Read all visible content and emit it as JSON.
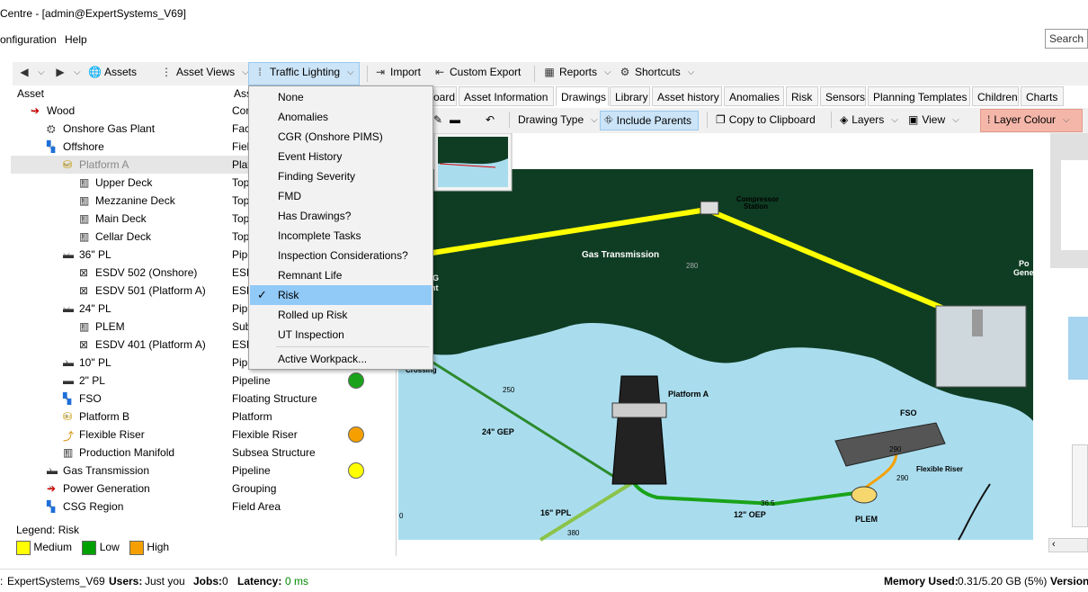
{
  "window": {
    "title": "Centre - [admin@ExpertSystems_V69]"
  },
  "menu": {
    "items": [
      "onfiguration",
      "Help"
    ],
    "search_placeholder": "Search N"
  },
  "toolbar": {
    "assets": "Assets",
    "asset_views": "Asset Views",
    "traffic_lighting": "Traffic Lighting",
    "import": "Import",
    "custom_export": "Custom Export",
    "reports": "Reports",
    "shortcuts": "Shortcuts"
  },
  "tree": {
    "col_asset": "Asset",
    "col_type": "Ass",
    "rows": [
      {
        "name": "Wood",
        "type": "Cor"
      },
      {
        "name": "Onshore Gas Plant",
        "type": "Fac"
      },
      {
        "name": "Offshore",
        "type": "Fiel"
      },
      {
        "name": "Platform A",
        "type": "Plat"
      },
      {
        "name": "Upper Deck",
        "type": "Top"
      },
      {
        "name": "Mezzanine Deck",
        "type": "Top"
      },
      {
        "name": "Main Deck",
        "type": "Top"
      },
      {
        "name": "Cellar Deck",
        "type": "Top"
      },
      {
        "name": "36\" PL",
        "type": "Pipe"
      },
      {
        "name": "ESDV 502 (Onshore)",
        "type": "ESD"
      },
      {
        "name": "ESDV 501 (Platform A)",
        "type": "ESD"
      },
      {
        "name": "24\" PL",
        "type": "Pip"
      },
      {
        "name": "PLEM",
        "type": "Sub"
      },
      {
        "name": "ESDV 401 (Platform A)",
        "type": "ESD"
      },
      {
        "name": "10\" PL",
        "type": "Pip"
      },
      {
        "name": "2\" PL",
        "type": "Pipeline",
        "risk": "Low"
      },
      {
        "name": "FSO",
        "type": "Floating Structure"
      },
      {
        "name": "Platform B",
        "type": "Platform"
      },
      {
        "name": "Flexible Riser",
        "type": "Flexible Riser",
        "risk": "High"
      },
      {
        "name": "Production Manifold",
        "type": "Subsea Structure"
      },
      {
        "name": "Gas Transmission",
        "type": "Pipeline",
        "risk": "Medium"
      },
      {
        "name": "Power Generation",
        "type": "Grouping"
      },
      {
        "name": "CSG Region",
        "type": "Field Area"
      }
    ]
  },
  "legend": {
    "title": "Legend: Risk",
    "items": [
      {
        "label": "Medium",
        "color": "#ffff00"
      },
      {
        "label": "Low",
        "color": "#00a000"
      },
      {
        "label": "High",
        "color": "#f5a000"
      }
    ]
  },
  "risk_colors": {
    "Low": "#1aa31a",
    "High": "#f5a000",
    "Medium": "#ffff00"
  },
  "tabs": [
    "oard",
    "Asset Information",
    "Drawings",
    "Library",
    "Asset history",
    "Anomalies",
    "Risk",
    "Sensors",
    "Planning Templates",
    "Children",
    "Charts"
  ],
  "drawings_toolbar": {
    "drawing_type": "Drawing Type",
    "include_parents": "Include Parents",
    "copy_clipboard": "Copy to Clipboard",
    "layers": "Layers",
    "view": "View",
    "layer_colour": "Layer Colour"
  },
  "dropdown": {
    "items": [
      "None",
      "Anomalies",
      "CGR (Onshore PIMS)",
      "Event History",
      "Finding Severity",
      "FMD",
      "Has Drawings?",
      "Incomplete Tasks",
      "Inspection Considerations?",
      "Remnant Life",
      "Risk",
      "Rolled up Risk",
      "UT Inspection"
    ],
    "checked": "Risk",
    "footer": "Active Workpack..."
  },
  "drawing": {
    "labels": {
      "compressor": "Compressor",
      "station": "Station",
      "gas_transmission": "Gas Transmission",
      "po": "Po",
      "gene": "Gene",
      "g": "G",
      "nt": "nt",
      "crossing": "Crossing",
      "platform_a": "Platform A",
      "fso": "FSO",
      "flexible_riser": "Flexible Riser",
      "plem": "PLEM",
      "pl24": "24\" GEP",
      "pl16": "16\" PPL",
      "pl12": "12\" OEP"
    },
    "numbers": [
      "280",
      "250",
      "290",
      "290",
      "36.5",
      "380",
      "0"
    ]
  },
  "status": {
    "db_label": ":",
    "db_value": "ExpertSystems_V69",
    "users_label": "Users:",
    "users_value": "Just you",
    "jobs_label": "Jobs:",
    "jobs_value": "0",
    "latency_label": "Latency:",
    "latency_value": "0 ms",
    "memory_label": "Memory Used:",
    "memory_value": "0.31/5.20 GB (5%)",
    "version_label": "Version"
  }
}
